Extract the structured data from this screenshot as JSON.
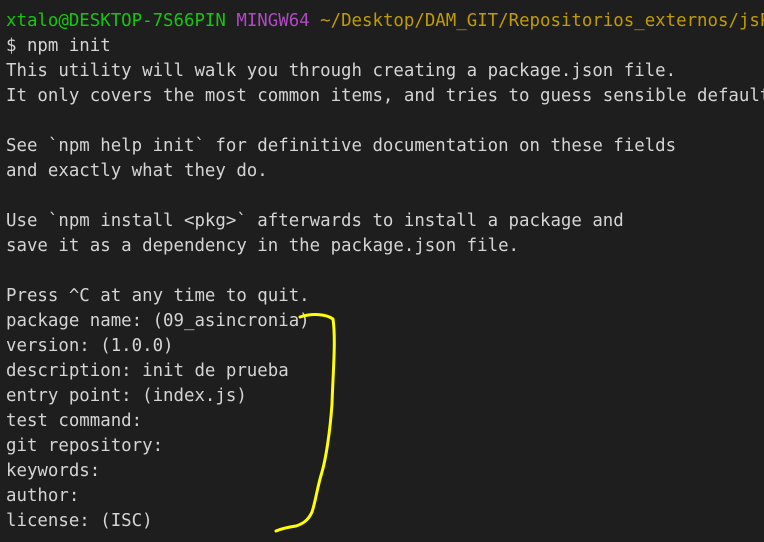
{
  "prompt": {
    "user_host": "xtalo@DESKTOP-7S66PIN",
    "env": "MINGW64",
    "path": "~/Desktop/DAM_GIT/Repositorios_externos/jsPrac"
  },
  "command": "$ npm init",
  "output": [
    "This utility will walk you through creating a package.json file.",
    "It only covers the most common items, and tries to guess sensible defaults.",
    "",
    "See `npm help init` for definitive documentation on these fields",
    "and exactly what they do.",
    "",
    "Use `npm install <pkg>` afterwards to install a package and",
    "save it as a dependency in the package.json file.",
    "",
    "Press ^C at any time to quit.",
    "package name: (09_asincronia)",
    "version: (1.0.0)",
    "description: init de prueba",
    "entry point: (index.js)",
    "test command:",
    "git repository:",
    "keywords:",
    "author:",
    "license: (ISC)"
  ],
  "annotation": {
    "color": "#ffff00",
    "shape": "bracket"
  }
}
